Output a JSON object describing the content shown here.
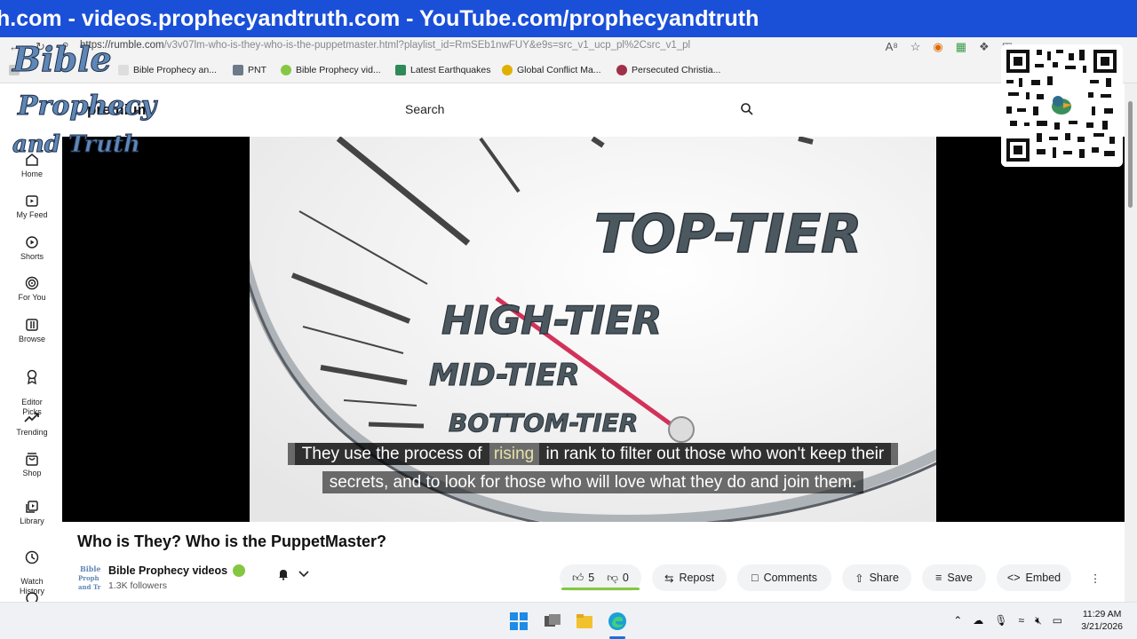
{
  "banner": {
    "text": "h.com - videos.prophecyandtruth.com - YouTube.com/prophecyandtruth"
  },
  "browser": {
    "url_host": "https://rumble.com",
    "url_path": "/v3v07lm-who-is-they-who-is-the-puppetmaster.html?playlist_id=RmSEb1nwFUY&e9s=src_v1_ucp_pl%2Csrc_v1_pl",
    "bookmarks": [
      {
        "label": "Bible Prophecy an...",
        "color": "#ffffff"
      },
      {
        "label": "PNT",
        "color": "#6c7a8a"
      },
      {
        "label": "Bible Prophecy vid...",
        "color": "#85c742"
      },
      {
        "label": "Latest Earthquakes",
        "color": "#2e8b57"
      },
      {
        "label": "Global Conflict Ma...",
        "color": "#e0b000"
      },
      {
        "label": "Persecuted Christia...",
        "color": "#a0304a"
      }
    ]
  },
  "site": {
    "logo_text": "premium",
    "search_placeholder": "Search"
  },
  "sidebar": {
    "items": [
      {
        "label": "Home",
        "icon": "home-icon"
      },
      {
        "label": "My Feed",
        "icon": "feed-icon"
      },
      {
        "label": "Shorts",
        "icon": "shorts-icon"
      },
      {
        "label": "For You",
        "icon": "target-icon"
      },
      {
        "label": "Browse",
        "icon": "browse-icon"
      },
      {
        "label": "Editor\nPicks",
        "icon": "award-icon"
      },
      {
        "label": "Trending",
        "icon": "trending-icon"
      },
      {
        "label": "Shop",
        "icon": "shop-icon"
      },
      {
        "label": "Library",
        "icon": "library-icon"
      },
      {
        "label": "Watch\nHistory",
        "icon": "history-icon"
      }
    ]
  },
  "video": {
    "gauge_labels": [
      "TOP-TIER",
      "HIGH-TIER",
      "MID-TIER",
      "BOTTOM-TIER"
    ],
    "caption_line1_a": "They use the process of",
    "caption_line1_hl": "rising",
    "caption_line1_b": "in rank to filter out those who won't keep their",
    "caption_line2": "secrets, and to look for those who will love what they do and join them."
  },
  "info": {
    "title": "Who is They? Who is the PuppetMaster?",
    "channel_name": "Bible Prophecy videos",
    "followers": "1.3K followers",
    "likes": "5",
    "dislikes": "0",
    "actions": {
      "repost": "Repost",
      "comments": "Comments",
      "share": "Share",
      "save": "Save",
      "embed": "Embed"
    }
  },
  "watermark": {
    "words": [
      "Bible",
      "Prophecy",
      "and Truth"
    ]
  },
  "taskbar": {
    "time": "11:29 AM",
    "date": "3/21/2026"
  }
}
